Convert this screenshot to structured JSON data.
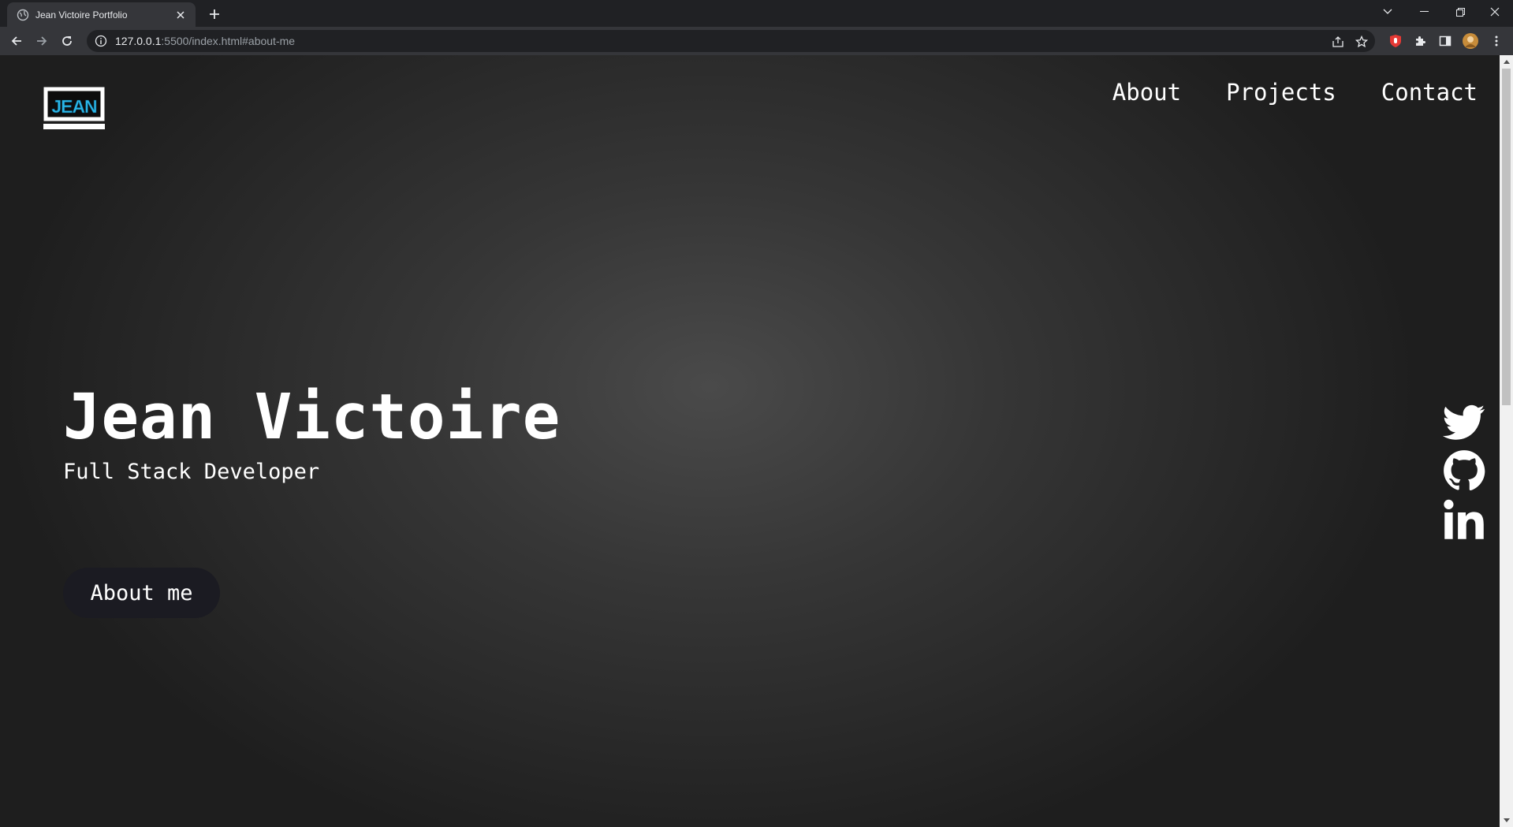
{
  "browser": {
    "tab_title": "Jean Victoire Portfolio",
    "url_host": "127.0.0.1",
    "url_path": ":5500/index.html#about-me"
  },
  "site": {
    "logo_text": "JEAN",
    "nav": [
      {
        "label": "About"
      },
      {
        "label": "Projects"
      },
      {
        "label": "Contact"
      }
    ],
    "hero": {
      "name": "Jean Victoire",
      "role": "Full Stack Developer",
      "button": "About me"
    },
    "social": [
      {
        "icon": "twitter-icon"
      },
      {
        "icon": "github-icon"
      },
      {
        "icon": "linkedin-icon"
      }
    ]
  },
  "colors": {
    "chrome_dark": "#202124",
    "chrome_toolbar": "#35363a",
    "logo_accent": "#29b6e8",
    "button_bg": "#1b1b22",
    "text": "#ffffff"
  }
}
